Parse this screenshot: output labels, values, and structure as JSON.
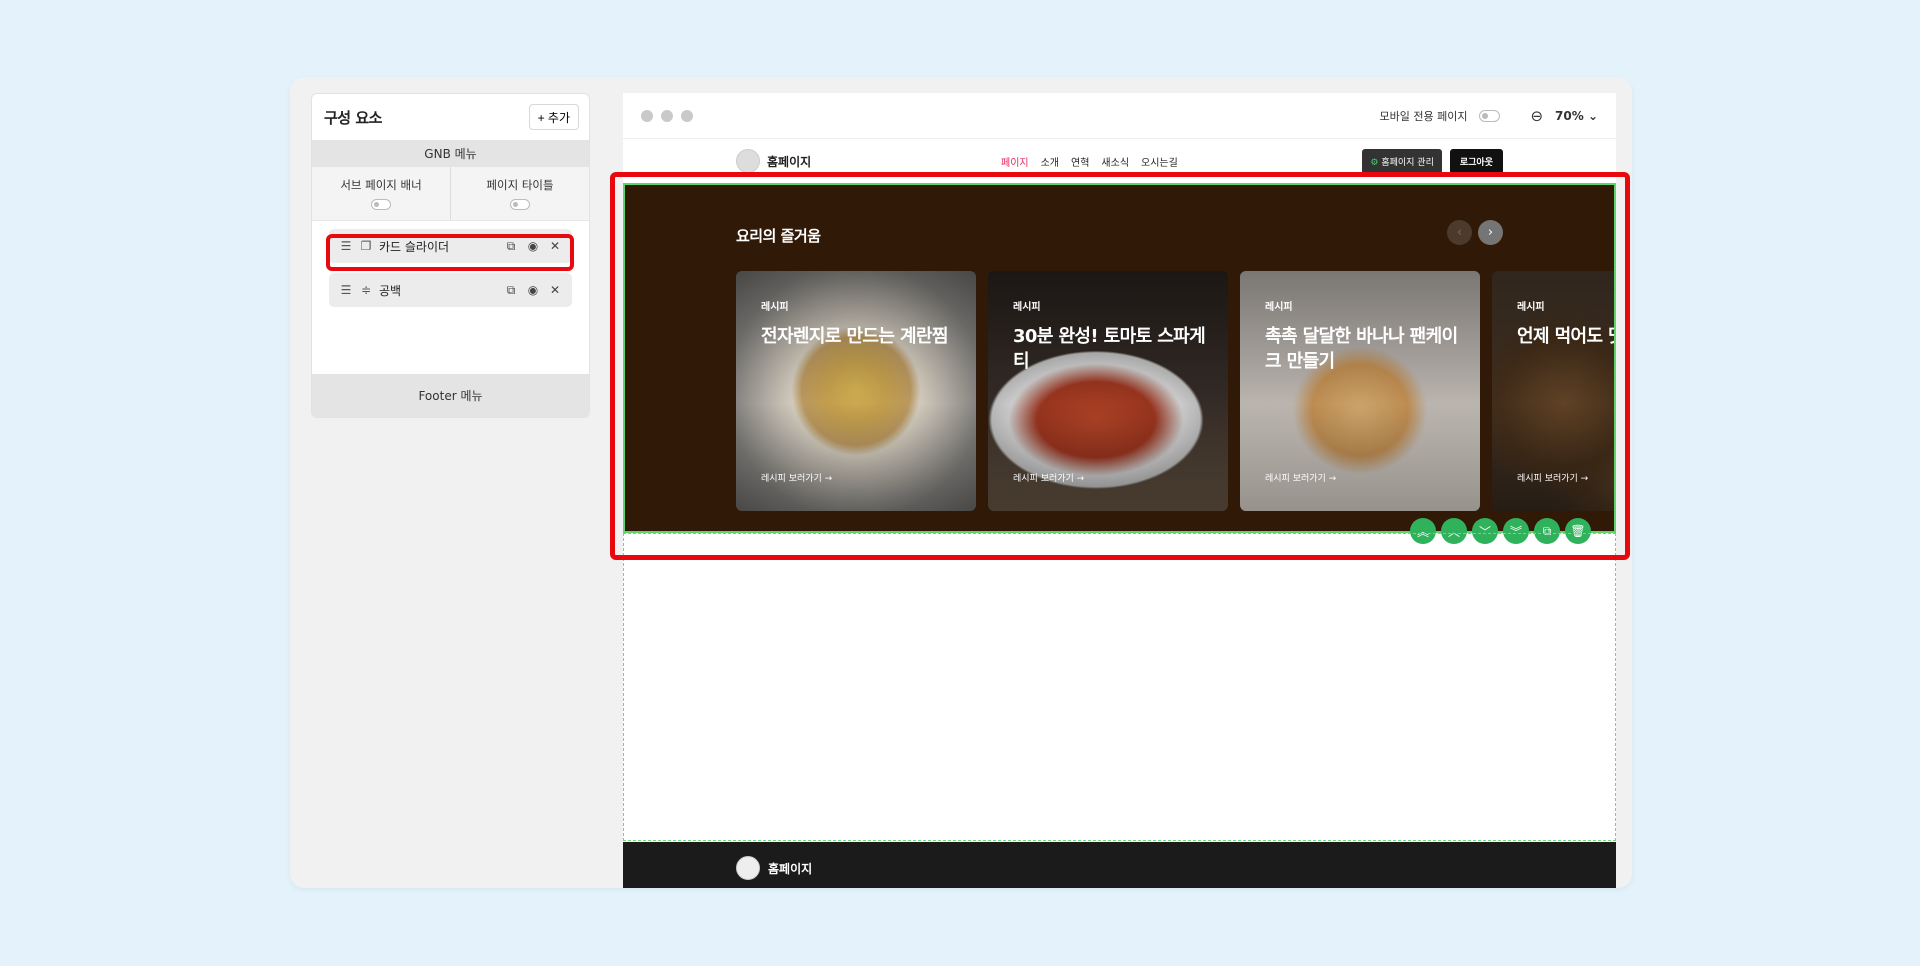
{
  "panel": {
    "title": "구성 요소",
    "add_label": "+ 추가",
    "gnb_label": "GNB 메뉴",
    "sub_banner_label": "서브 페이지 배너",
    "page_title_label": "페이지 타이틀",
    "components": [
      {
        "label": "카드 슬라이더",
        "icon": "cards-icon"
      },
      {
        "label": "공백",
        "icon": "spacer-icon"
      }
    ],
    "footer_label": "Footer 메뉴"
  },
  "toolbar": {
    "mobile_only_label": "모바일 전용 페이지",
    "zoom": "70%"
  },
  "site": {
    "logo_text": "홈페이지",
    "nav": [
      "페이지",
      "소개",
      "연혁",
      "새소식",
      "오시는길"
    ],
    "manage_label": "홈페이지 관리",
    "logout_label": "로그아웃"
  },
  "slider": {
    "title": "요리의 즐거움",
    "cards": [
      {
        "tag": "레시피",
        "title": "전자렌지로 만드는 계란찜",
        "link": "레시피 보러가기 →"
      },
      {
        "tag": "레시피",
        "title": "30분 완성! 토마토 스파게티",
        "link": "레시피 보러가기 →"
      },
      {
        "tag": "레시피",
        "title": "촉촉 달달한 바나나 팬케이크 만들기",
        "link": "레시피 보러가기 →"
      },
      {
        "tag": "레시피",
        "title": "언제 먹어도 맛",
        "link": "레시피 보러가기 →"
      }
    ]
  },
  "footer": {
    "logo_text": "홈페이지"
  },
  "colors": {
    "highlight": "#e8090f",
    "slider_bg": "#301906",
    "action_green": "#2fb25b",
    "nav_active": "#e6265a"
  }
}
